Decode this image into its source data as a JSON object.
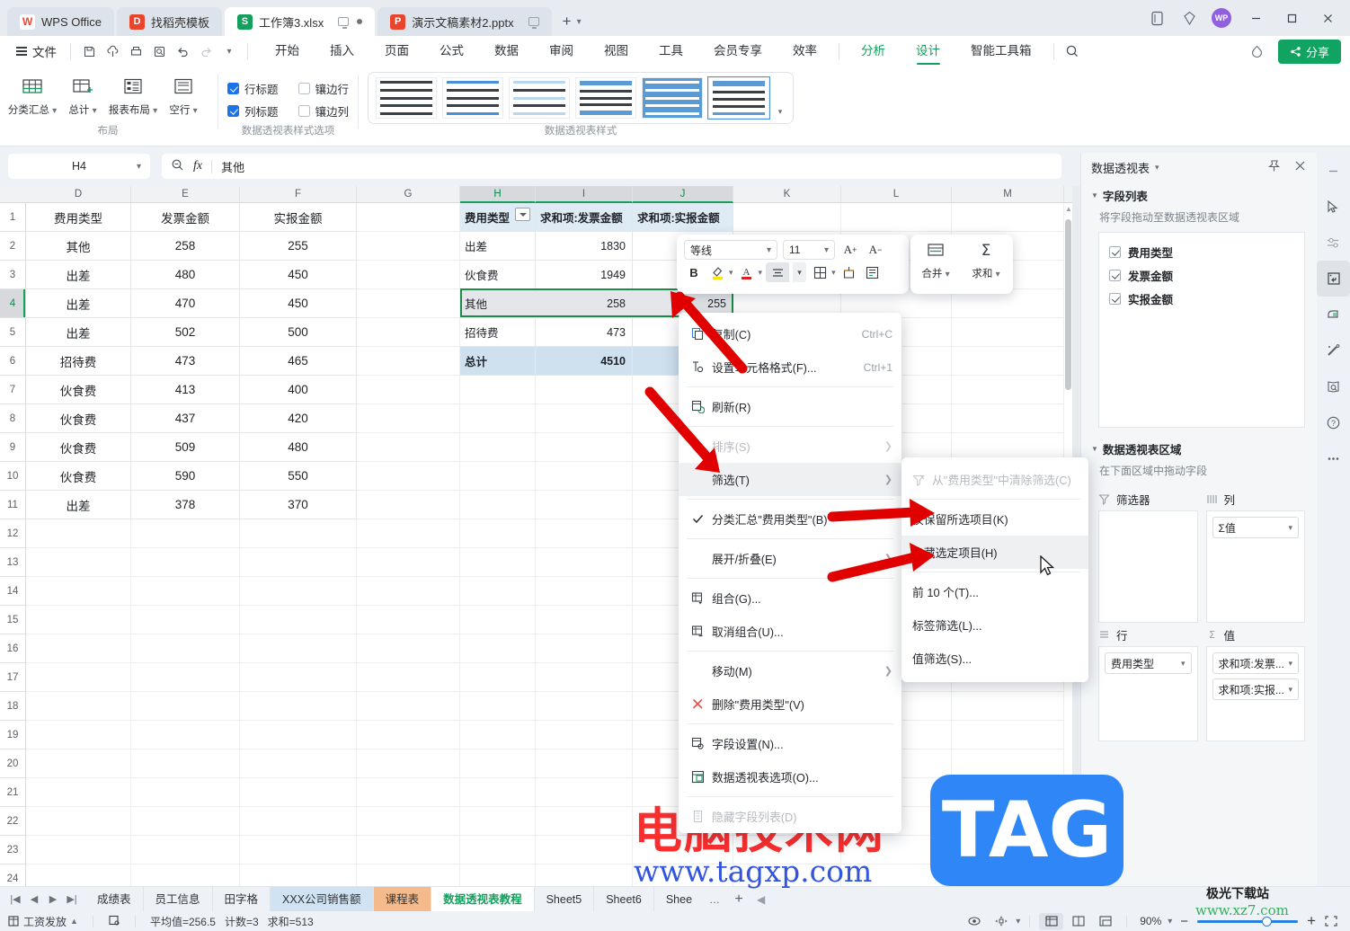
{
  "titlebar": {
    "app_name": "WPS Office",
    "tabs": [
      {
        "label": "找稻壳模板",
        "icon": "wps-docer-icon",
        "kind": "docer"
      },
      {
        "label": "工作簿3.xlsx",
        "icon": "excel-icon",
        "kind": "xlsx",
        "active": true
      },
      {
        "label": "演示文稿素材2.pptx",
        "icon": "powerpoint-icon",
        "kind": "pptx"
      }
    ],
    "avatar_text": "WP"
  },
  "menubar": {
    "file_label": "文件",
    "tabs": [
      {
        "label": "开始"
      },
      {
        "label": "插入"
      },
      {
        "label": "页面"
      },
      {
        "label": "公式"
      },
      {
        "label": "数据"
      },
      {
        "label": "审阅"
      },
      {
        "label": "视图"
      },
      {
        "label": "工具"
      },
      {
        "label": "会员专享"
      },
      {
        "label": "效率"
      },
      {
        "label": "分析",
        "style": "green"
      },
      {
        "label": "设计",
        "style": "active"
      },
      {
        "label": "智能工具箱"
      }
    ],
    "share_label": "分享"
  },
  "ribbon": {
    "layout_group": {
      "label": "布局",
      "buttons": [
        {
          "label": "分类汇总",
          "icon": "subtotal-icon",
          "dropdown": true
        },
        {
          "label": "总计",
          "icon": "grand-total-icon",
          "dropdown": true
        },
        {
          "label": "报表布局",
          "icon": "report-layout-icon",
          "dropdown": true
        },
        {
          "label": "空行",
          "icon": "blank-row-icon",
          "dropdown": true
        }
      ]
    },
    "style_options_group": {
      "label": "数据透视表样式选项",
      "checks": [
        {
          "label": "行标题",
          "checked": true
        },
        {
          "label": "镶边行",
          "checked": false
        },
        {
          "label": "列标题",
          "checked": true
        },
        {
          "label": "镶边列",
          "checked": false
        }
      ]
    },
    "styles_group": {
      "label": "数据透视表样式",
      "thumb_count": 6,
      "selected_index": 5
    }
  },
  "formula_bar": {
    "name_box": "H4",
    "formula": "其他",
    "search_icon": "zoom-search-icon",
    "fx_label": "fx"
  },
  "grid": {
    "columns": [
      "D",
      "E",
      "F",
      "G",
      "H",
      "I",
      "J",
      "K",
      "L",
      "M"
    ],
    "selected_columns": [
      "H",
      "I",
      "J"
    ],
    "selected_row": "4",
    "rows": [
      "1",
      "2",
      "3",
      "4",
      "5",
      "6",
      "7",
      "8",
      "9",
      "10",
      "11",
      "12",
      "13",
      "14",
      "15",
      "16",
      "17",
      "18",
      "19",
      "20",
      "21",
      "22",
      "23",
      "24"
    ],
    "source_table": {
      "headers": [
        "费用类型",
        "发票金额",
        "实报金额"
      ],
      "rows": [
        [
          "其他",
          "258",
          "255"
        ],
        [
          "出差",
          "480",
          "450"
        ],
        [
          "出差",
          "470",
          "450"
        ],
        [
          "出差",
          "502",
          "500"
        ],
        [
          "招待费",
          "473",
          "465"
        ],
        [
          "伙食费",
          "413",
          "400"
        ],
        [
          "伙食费",
          "437",
          "420"
        ],
        [
          "伙食费",
          "509",
          "480"
        ],
        [
          "伙食费",
          "590",
          "550"
        ],
        [
          "出差",
          "378",
          "370"
        ]
      ]
    },
    "pivot_table": {
      "headers": [
        "费用类型",
        "求和项:发票金额",
        "求和项:实报金额"
      ],
      "rows": [
        [
          "出差",
          "1830",
          ""
        ],
        [
          "伙食费",
          "1949",
          ""
        ],
        [
          "其他",
          "258",
          "255"
        ],
        [
          "招待费",
          "473",
          ""
        ]
      ],
      "total_row": [
        "总计",
        "4510",
        ""
      ]
    }
  },
  "mini_toolbar": {
    "font_name": "等线",
    "font_size": "11",
    "grow_font": "A+",
    "shrink_font": "A-",
    "bold": "B",
    "highlight_icon": "highlight-color-icon",
    "font_color_icon": "font-color-icon",
    "align_icon": "align-center-icon",
    "borders_icon": "borders-icon",
    "format_painter_icon": "format-painter-icon",
    "wrap_icon": "wrap-text-icon",
    "merge_label": "合并",
    "sum_label": "求和"
  },
  "context_menu": {
    "items": [
      {
        "label": "复制(C)",
        "icon": "copy-icon",
        "shortcut": "Ctrl+C"
      },
      {
        "label": "设置单元格格式(F)...",
        "icon": "format-cells-icon",
        "shortcut": "Ctrl+1"
      },
      {
        "sep": true
      },
      {
        "label": "刷新(R)",
        "icon": "refresh-icon"
      },
      {
        "sep": true
      },
      {
        "label": "排序(S)",
        "icon": "",
        "arrow": "›",
        "disabled": true
      },
      {
        "label": "筛选(T)",
        "icon": "",
        "arrow": "›",
        "hover": true
      },
      {
        "sep": true
      },
      {
        "label": "分类汇总\"费用类型\"(B)",
        "icon": "check-icon"
      },
      {
        "sep": true
      },
      {
        "label": "展开/折叠(E)",
        "icon": "",
        "arrow": "›"
      },
      {
        "sep": true
      },
      {
        "label": "组合(G)...",
        "icon": "group-icon"
      },
      {
        "label": "取消组合(U)...",
        "icon": "ungroup-icon"
      },
      {
        "sep": true
      },
      {
        "label": "移动(M)",
        "icon": "",
        "arrow": "›"
      },
      {
        "label": "删除\"费用类型\"(V)",
        "icon": "delete-x-icon"
      },
      {
        "sep": true
      },
      {
        "label": "字段设置(N)...",
        "icon": "field-settings-icon"
      },
      {
        "label": "数据透视表选项(O)...",
        "icon": "pivot-options-icon"
      },
      {
        "sep": true
      },
      {
        "label": "隐藏字段列表(D)",
        "icon": "hide-field-list-icon",
        "disabled": true
      }
    ]
  },
  "submenu": {
    "items": [
      {
        "label": "从\"费用类型\"中清除筛选(C)",
        "icon": "clear-filter-icon",
        "disabled": true
      },
      {
        "sep": true
      },
      {
        "label": "仅保留所选项目(K)"
      },
      {
        "label": "隐藏选定项目(H)",
        "hover": true
      },
      {
        "sep": true
      },
      {
        "label": "前 10 个(T)..."
      },
      {
        "label": "标签筛选(L)..."
      },
      {
        "label": "值筛选(S)..."
      }
    ]
  },
  "right_panel": {
    "title": "数据透视表",
    "pin_icon": "pin-icon",
    "close_icon": "close-icon",
    "field_list_title": "字段列表",
    "field_list_hint": "将字段拖动至数据透视表区域",
    "fields": [
      {
        "label": "费用类型",
        "checked": true
      },
      {
        "label": "发票金额",
        "checked": true
      },
      {
        "label": "实报金额",
        "checked": true
      }
    ],
    "areas_title": "数据透视表区域",
    "areas_hint": "在下面区域中拖动字段",
    "filter_label": "筛选器",
    "column_label": "列",
    "row_label": "行",
    "value_label": "值",
    "column_items": [
      "Σ值"
    ],
    "filter_items": [],
    "row_items": [
      "费用类型"
    ],
    "value_items": [
      "求和项:发票...",
      "求和项:实报..."
    ]
  },
  "rail": {
    "icons": [
      "cursor-icon",
      "settings-sliders-icon",
      "pivot-table-icon",
      "eraser-icon",
      "tools-icon",
      "book-search-icon",
      "help-icon",
      "more-icon"
    ],
    "active_index": 2
  },
  "sheet_tabs": {
    "tabs": [
      {
        "label": "成绩表"
      },
      {
        "label": "员工信息"
      },
      {
        "label": "田字格"
      },
      {
        "label": "XXX公司销售额",
        "color": "blue"
      },
      {
        "label": "课程表",
        "color": "orange"
      },
      {
        "label": "数据透视表教程",
        "active": true
      },
      {
        "label": "Sheet5"
      },
      {
        "label": "Sheet6"
      },
      {
        "label": "Shee"
      }
    ],
    "more": "…",
    "add": "+"
  },
  "status_bar": {
    "workbook_label": "工资发放",
    "stats": [
      "平均值=256.5",
      "计数=3",
      "求和=513"
    ],
    "zoom": "90%",
    "view_modes": [
      "normal-view-icon",
      "page-layout-icon",
      "page-break-icon"
    ],
    "minus": "−",
    "plus": "+"
  },
  "watermarks": {
    "cn_text": "电脑技术网",
    "url_text": "www.tagxp.com",
    "tag_text": "TAG",
    "site1": "极光下载站",
    "site2": "www.xz7.com"
  }
}
